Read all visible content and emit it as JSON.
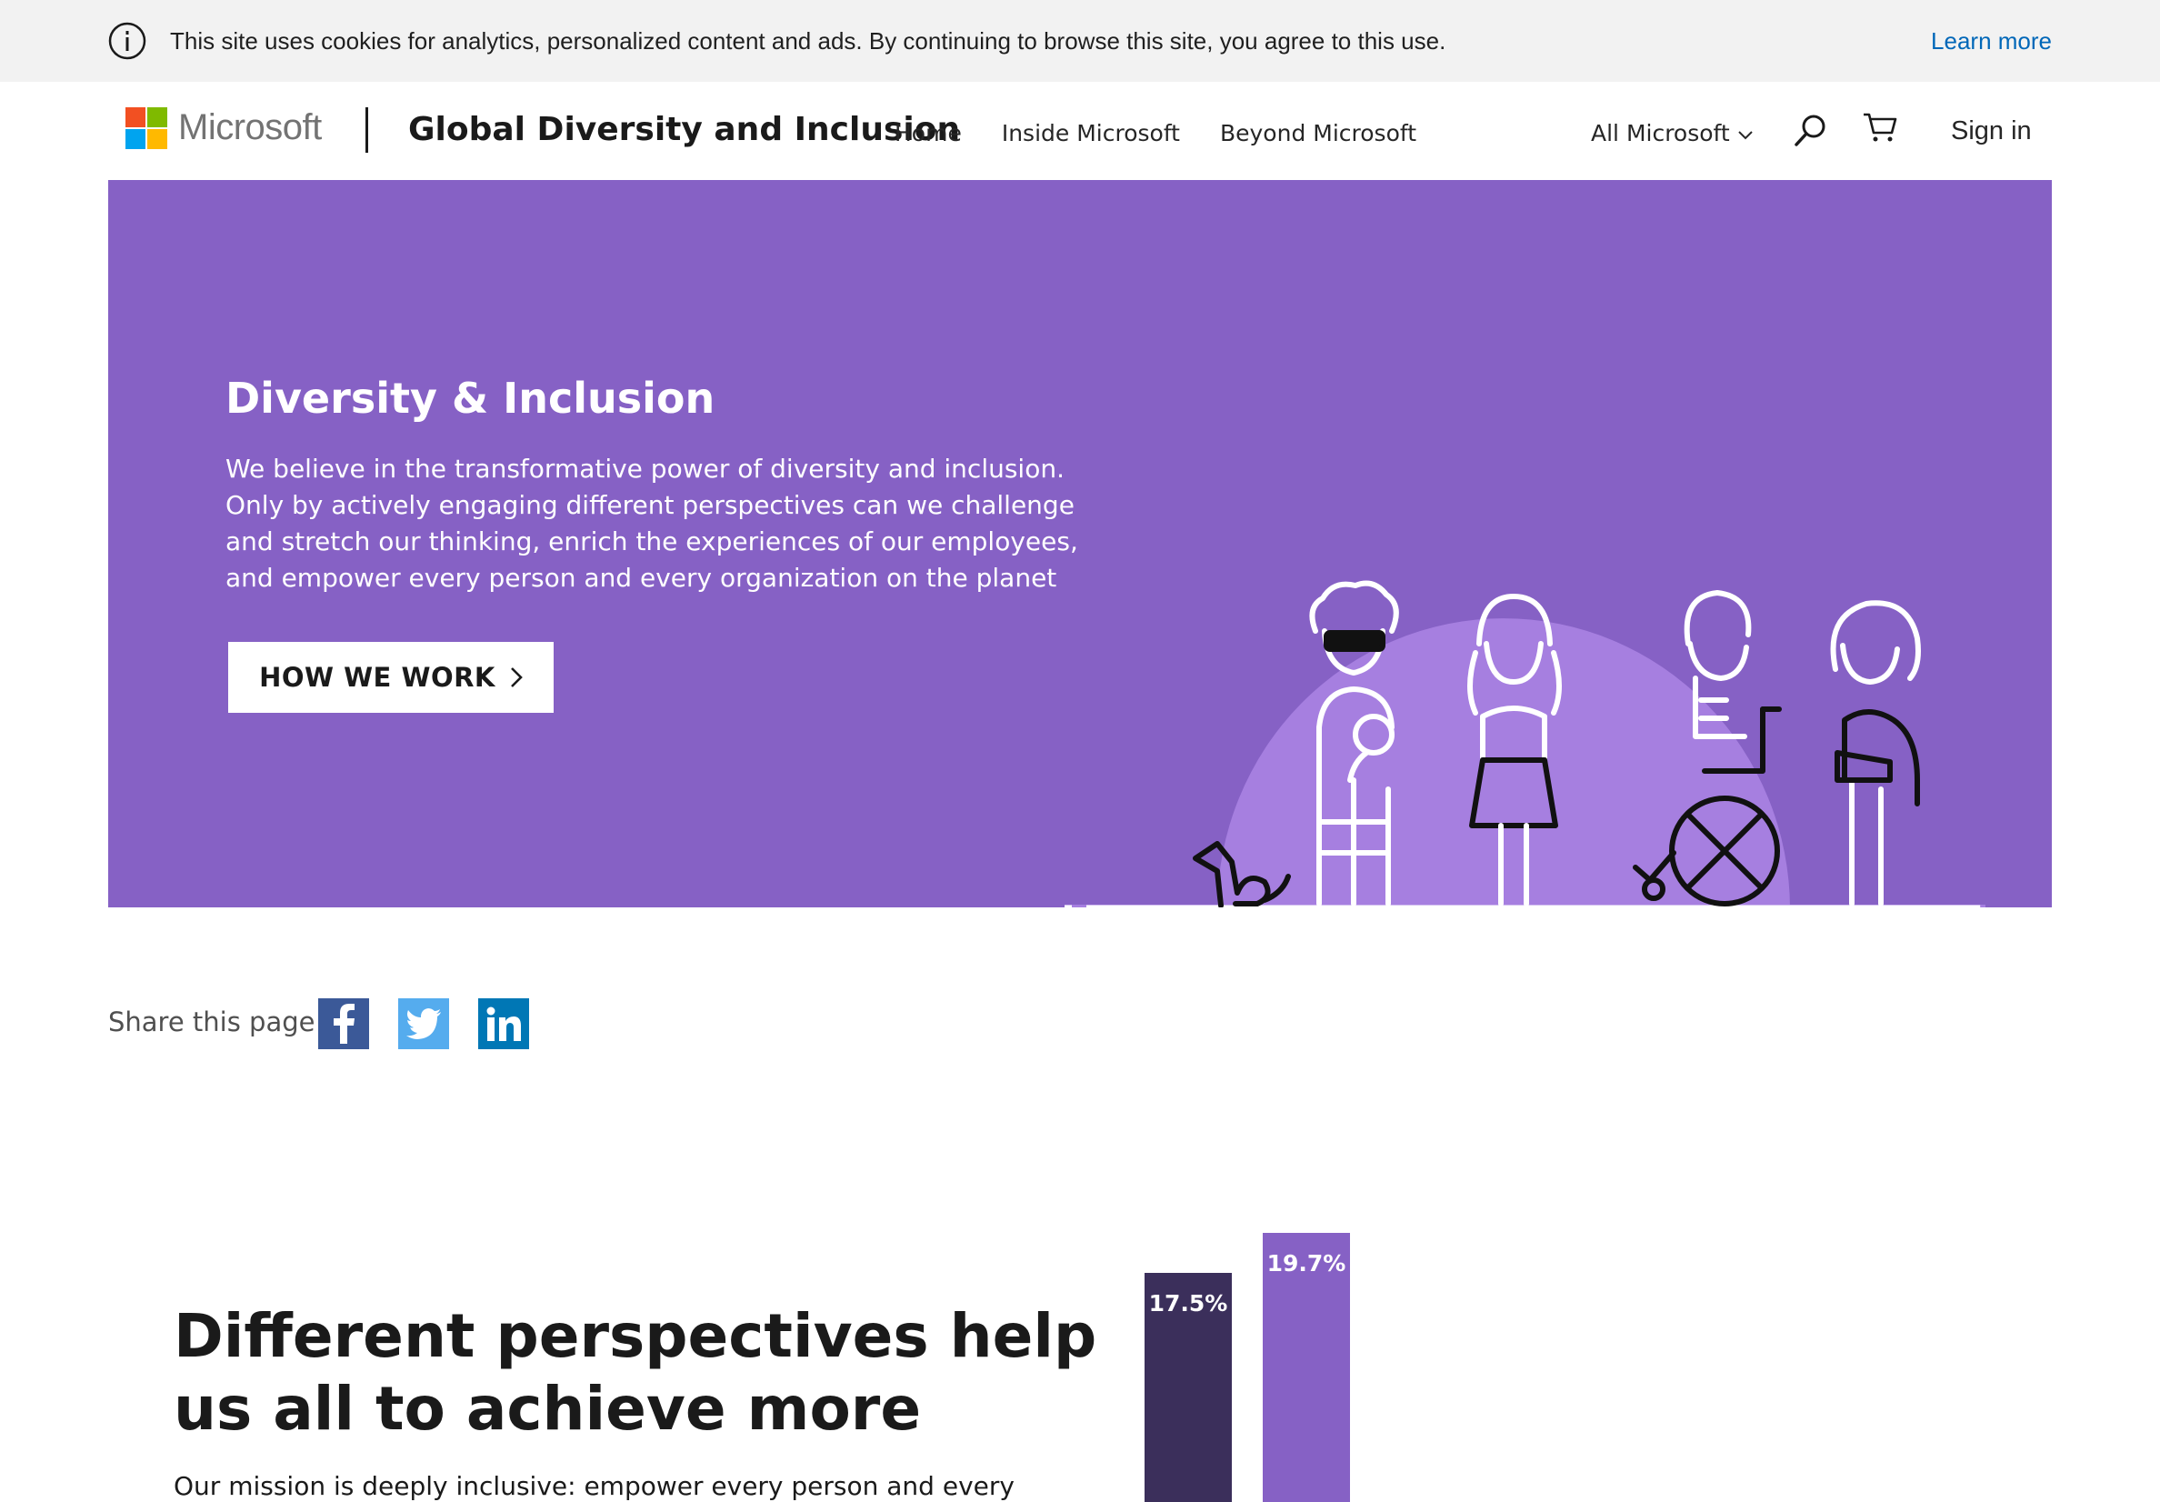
{
  "cookie_bar": {
    "message": "This site uses cookies for analytics, personalized content and ads. By continuing to browse this site, you agree to this use.",
    "learn_more": "Learn more"
  },
  "header": {
    "brand": "Microsoft",
    "site_title": "Global Diversity and Inclusion",
    "nav": [
      "Home",
      "Inside Microsoft",
      "Beyond Microsoft"
    ],
    "all_microsoft": "All Microsoft",
    "sign_in": "Sign in",
    "logo_colors": [
      "#f25022",
      "#7fba00",
      "#00a4ef",
      "#ffb900"
    ]
  },
  "hero": {
    "title": "Diversity & Inclusion",
    "text_lines": [
      "We believe in the transformative power of diversity and inclusion.",
      "Only by actively engaging different perspectives can we challenge",
      "and stretch our thinking, enrich the experiences of our employees,",
      "and empower every person and every organization on the planet"
    ],
    "cta": "HOW WE WORK",
    "background": "#8661c5"
  },
  "share": {
    "label": "Share this page",
    "networks": [
      "facebook-icon",
      "twitter-icon",
      "linkedin-icon"
    ]
  },
  "mission": {
    "title_lines": [
      "Different perspectives help",
      "us all to achieve more"
    ],
    "text": "Our mission is deeply inclusive: empower every person and every"
  },
  "chart_data": {
    "type": "bar",
    "categories": [
      "",
      ""
    ],
    "values": [
      17.5,
      19.7
    ],
    "labels": [
      "17.5%",
      "19.7%"
    ],
    "colors": [
      "#3b2f5b",
      "#8661c5"
    ]
  }
}
